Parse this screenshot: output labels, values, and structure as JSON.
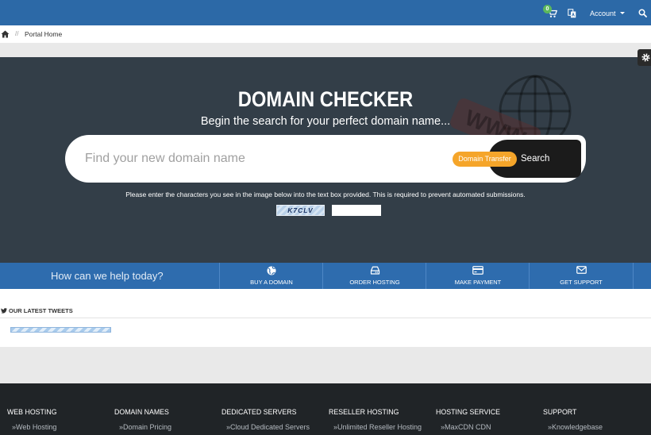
{
  "colors": {
    "topbar": "#2c69a7",
    "hero": "#333e48",
    "help_bar": "#2e6cae",
    "accent": "#f5a52a",
    "search_button": "#1b1b1b",
    "footer": "#202427",
    "cart_badge": "#5cb85c"
  },
  "topbar": {
    "cart": {
      "icon": "cart-icon",
      "count": "0"
    },
    "language_icon": "language-icon",
    "account_label": "Account",
    "search_icon": "search-icon"
  },
  "breadcrumb": {
    "home_icon": "home-icon",
    "separator": "//",
    "items": [
      "Portal Home"
    ]
  },
  "settings_icon": "gear-icon",
  "hero": {
    "title": "DOMAIN CHECKER",
    "subtitle": "Begin the search for your perfect domain name...",
    "watermark_text": "WWW",
    "search": {
      "placeholder": "Find your new domain name",
      "transfer_label": "Domain Transfer",
      "submit_label": "Search"
    },
    "captcha": {
      "instruction": "Please enter the characters you see in the image below into the text box provided. This is required to prevent automated submissions.",
      "image_text": "K7CLV"
    }
  },
  "help": {
    "heading": "How can we help today?",
    "items": [
      {
        "icon": "globe-icon",
        "label": "BUY A DOMAIN"
      },
      {
        "icon": "hdd-icon",
        "label": "ORDER HOSTING"
      },
      {
        "icon": "credit-card-icon",
        "label": "MAKE PAYMENT"
      },
      {
        "icon": "envelope-icon",
        "label": "GET SUPPORT"
      }
    ]
  },
  "tweets": {
    "icon": "twitter-icon",
    "heading": "OUR LATEST TWEETS"
  },
  "footer": {
    "columns": [
      {
        "heading": "WEB HOSTING",
        "links": [
          "»Web Hosting"
        ]
      },
      {
        "heading": "DOMAIN NAMES",
        "links": [
          "»Domain Pricing"
        ]
      },
      {
        "heading": "DEDICATED SERVERS",
        "links": [
          "»Cloud Dedicated Servers"
        ]
      },
      {
        "heading": "RESELLER HOSTING",
        "links": [
          "»Unlimited Reseller Hosting"
        ]
      },
      {
        "heading": "HOSTING SERVICE",
        "links": [
          "»MaxCDN CDN"
        ]
      },
      {
        "heading": "SUPPORT",
        "links": [
          "»Knowledgebase"
        ]
      }
    ]
  }
}
